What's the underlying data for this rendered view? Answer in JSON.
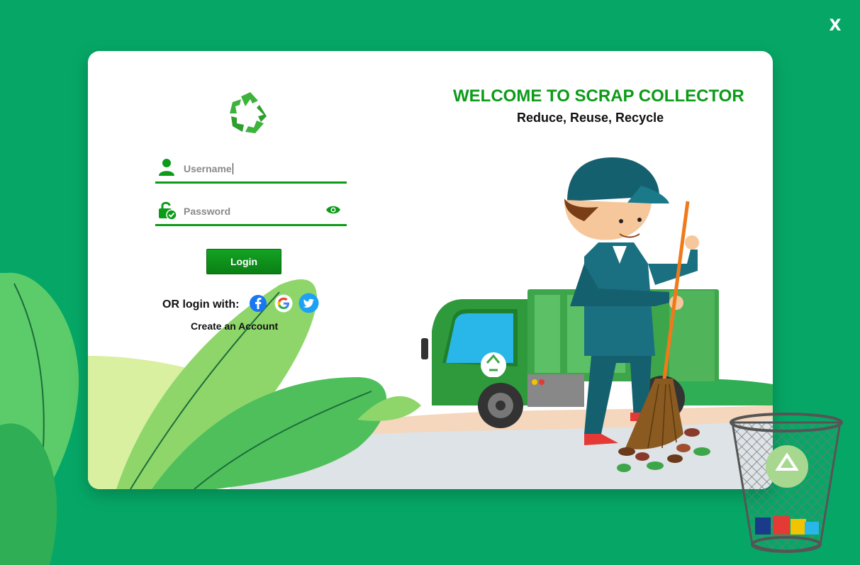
{
  "window": {
    "close_label": "X"
  },
  "login": {
    "username_placeholder": "Username",
    "password_placeholder": "Password",
    "login_label": "Login",
    "or_text": "OR login with:",
    "create_account": "Create an Account"
  },
  "hero": {
    "title": "WELCOME TO SCRAP COLLECTOR",
    "subtitle": "Reduce, Reuse, Recycle"
  },
  "colors": {
    "background": "#06a766",
    "accent": "#0c9b18",
    "card": "#ffffff"
  },
  "icons": [
    "recycle-logo-icon",
    "user-icon",
    "lock-icon",
    "eye-icon",
    "facebook-icon",
    "google-icon",
    "twitter-icon",
    "close-icon"
  ]
}
